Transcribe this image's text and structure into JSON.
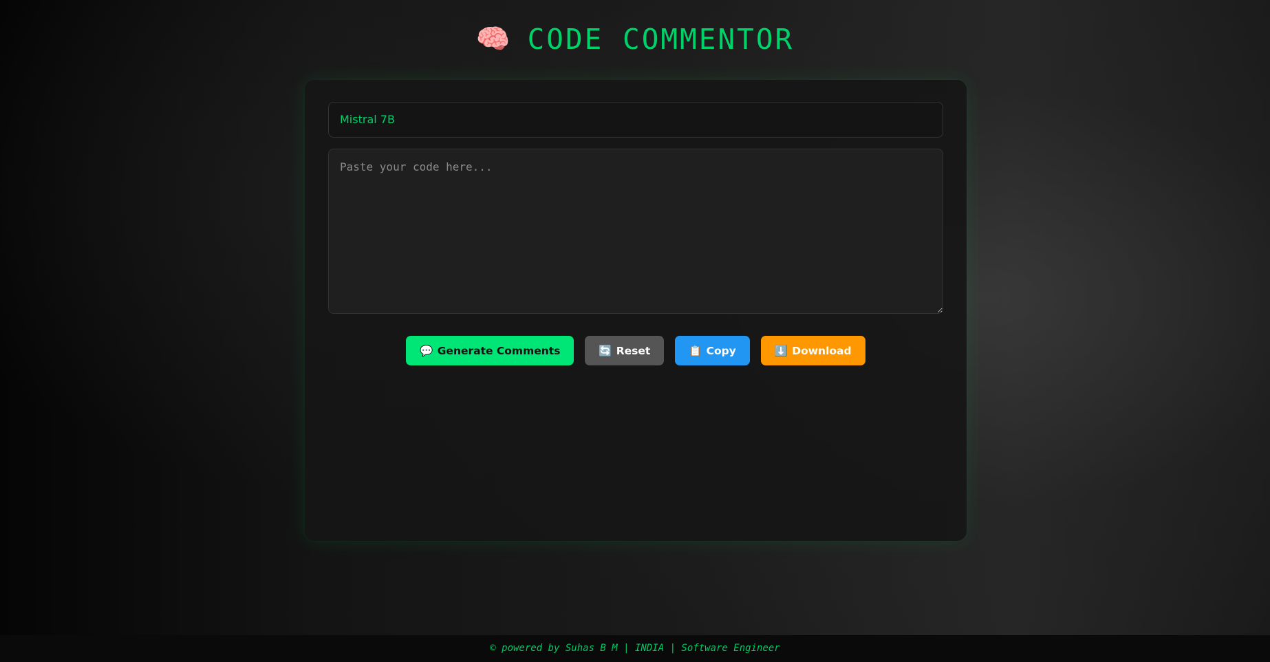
{
  "header": {
    "icon": "🧠",
    "icon_name": "brain-icon",
    "title": "CODE COMMENTOR"
  },
  "model_select": {
    "value": "Mistral 7B"
  },
  "code_input": {
    "placeholder": "Paste your code here...",
    "value": ""
  },
  "buttons": {
    "generate": {
      "icon": "💬",
      "icon_name": "speech-bubble-icon",
      "label": "Generate Comments"
    },
    "reset": {
      "icon": "🔄",
      "icon_name": "refresh-icon",
      "label": "Reset"
    },
    "copy": {
      "icon": "📋",
      "icon_name": "clipboard-icon",
      "label": "Copy"
    },
    "download": {
      "icon": "⬇️",
      "icon_name": "download-arrow-icon",
      "label": "Download"
    }
  },
  "footer": {
    "text": "© powered by Suhas B M | INDIA | Software Engineer"
  },
  "colors": {
    "accent": "#00e676",
    "reset": "#555555",
    "copy": "#2196f3",
    "download": "#ff9800",
    "card_background": "#161616"
  }
}
